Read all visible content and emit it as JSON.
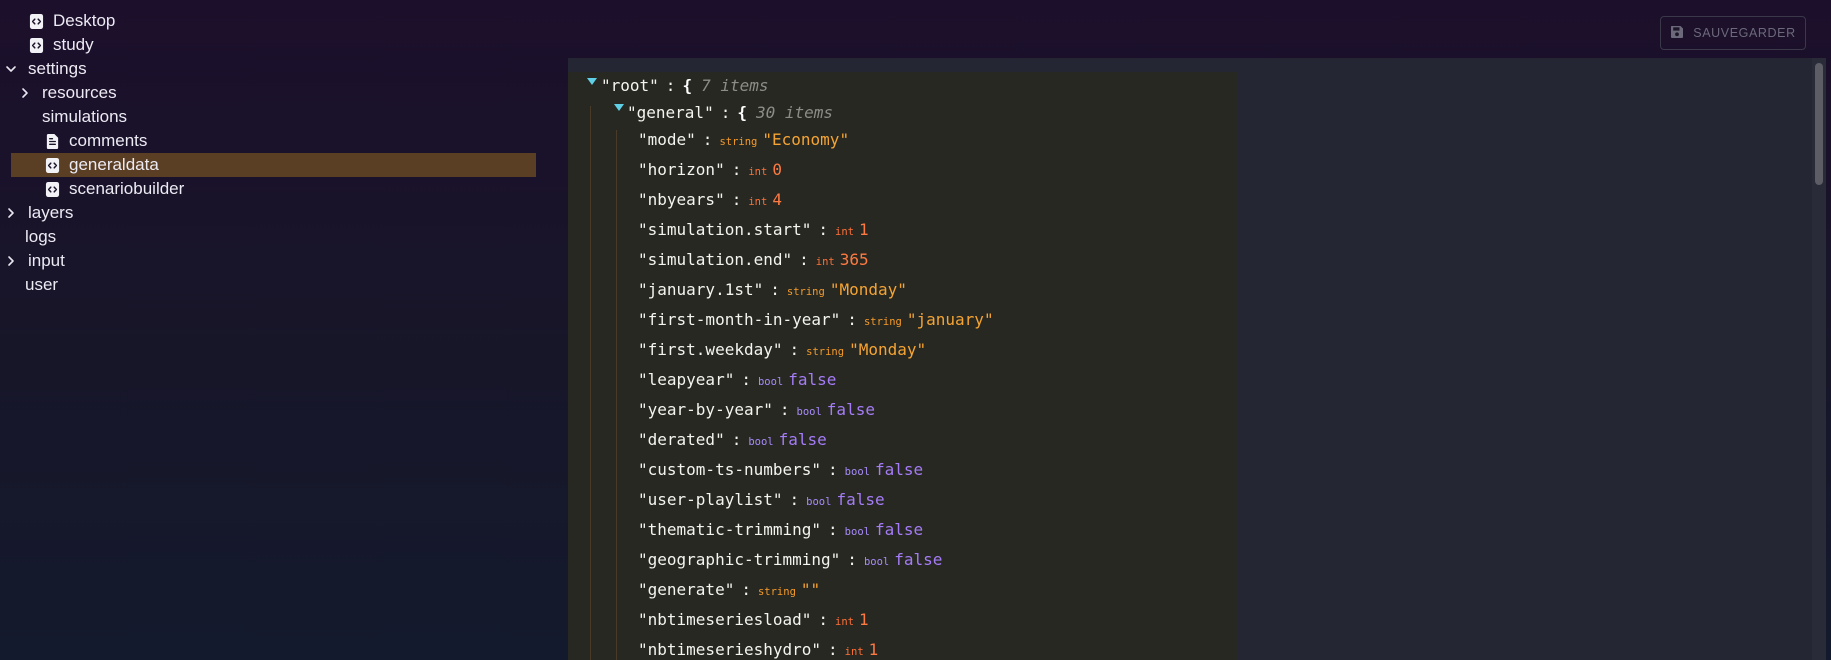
{
  "tree": {
    "items": [
      {
        "label": "Desktop",
        "icon": "file-code-icon",
        "level": 1,
        "chevron": "none"
      },
      {
        "label": "study",
        "icon": "file-code-icon",
        "level": 1,
        "chevron": "none"
      },
      {
        "label": "settings",
        "icon": "",
        "level": 0,
        "chevron": "expanded"
      },
      {
        "label": "resources",
        "icon": "",
        "level": 1,
        "chevron": "collapsed"
      },
      {
        "label": "simulations",
        "icon": "",
        "level": 1,
        "chevron": "none"
      },
      {
        "label": "comments",
        "icon": "file-text-icon",
        "level": 2,
        "chevron": "none"
      },
      {
        "label": "generaldata",
        "icon": "file-code-icon",
        "level": 2,
        "chevron": "none",
        "selected": true
      },
      {
        "label": "scenariobuilder",
        "icon": "file-code-icon",
        "level": 2,
        "chevron": "none"
      },
      {
        "label": "layers",
        "icon": "",
        "level": 0,
        "chevron": "collapsed"
      },
      {
        "label": "logs",
        "icon": "",
        "level": 0,
        "chevron": "none"
      },
      {
        "label": "input",
        "icon": "",
        "level": 0,
        "chevron": "collapsed"
      },
      {
        "label": "user",
        "icon": "",
        "level": 0,
        "chevron": "none"
      }
    ]
  },
  "toolbar": {
    "save_label": "SAUVEGARDER",
    "save_icon": "save-icon"
  },
  "json_view": {
    "root": {
      "key": "\"root\"",
      "brace": "{",
      "count": "7 items"
    },
    "general": {
      "key": "\"general\"",
      "brace": "{",
      "count": "30 items"
    },
    "entries": [
      {
        "key": "\"mode\"",
        "type": "string",
        "value": "\"Economy\""
      },
      {
        "key": "\"horizon\"",
        "type": "int",
        "value": "0"
      },
      {
        "key": "\"nbyears\"",
        "type": "int",
        "value": "4"
      },
      {
        "key": "\"simulation.start\"",
        "type": "int",
        "value": "1"
      },
      {
        "key": "\"simulation.end\"",
        "type": "int",
        "value": "365"
      },
      {
        "key": "\"january.1st\"",
        "type": "string",
        "value": "\"Monday\""
      },
      {
        "key": "\"first-month-in-year\"",
        "type": "string",
        "value": "\"january\""
      },
      {
        "key": "\"first.weekday\"",
        "type": "string",
        "value": "\"Monday\""
      },
      {
        "key": "\"leapyear\"",
        "type": "bool",
        "value": "false"
      },
      {
        "key": "\"year-by-year\"",
        "type": "bool",
        "value": "false"
      },
      {
        "key": "\"derated\"",
        "type": "bool",
        "value": "false"
      },
      {
        "key": "\"custom-ts-numbers\"",
        "type": "bool",
        "value": "false"
      },
      {
        "key": "\"user-playlist\"",
        "type": "bool",
        "value": "false"
      },
      {
        "key": "\"thematic-trimming\"",
        "type": "bool",
        "value": "false"
      },
      {
        "key": "\"geographic-trimming\"",
        "type": "bool",
        "value": "false"
      },
      {
        "key": "\"generate\"",
        "type": "string",
        "value": "\"\""
      },
      {
        "key": "\"nbtimeseriesload\"",
        "type": "int",
        "value": "1"
      },
      {
        "key": "\"nbtimeserieshydro\"",
        "type": "int",
        "value": "1"
      }
    ]
  },
  "colors": {
    "selected_row": "#5a3f24",
    "json_background": "#272822",
    "string_value": "#f5a433",
    "int_value": "#fd7a42",
    "bool_value": "#a47cf6"
  }
}
